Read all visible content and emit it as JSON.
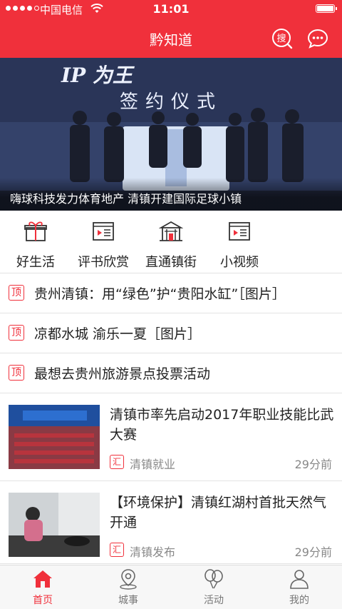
{
  "status_bar": {
    "carrier": "中国电信",
    "time": "11:01"
  },
  "header": {
    "title": "黔知道",
    "search_icon_char": "搜"
  },
  "banner": {
    "caption": "嗨球科技发力体育地产 清镇开建国际足球小镇",
    "stage_logo": "IP 为王",
    "stage_text": "签约仪式"
  },
  "quick_menu": [
    {
      "label": "好生活",
      "icon": "gift-icon"
    },
    {
      "label": "评书欣赏",
      "icon": "video-list-icon"
    },
    {
      "label": "直通镇街",
      "icon": "building-icon"
    },
    {
      "label": "小视频",
      "icon": "video-list-icon"
    }
  ],
  "pinned": {
    "tag": "顶",
    "items": [
      "贵州清镇：用“绿色”护“贵阳水缸”［图片］",
      "凉都水城 渝乐一夏［图片］",
      "最想去贵州旅游景点投票活动"
    ]
  },
  "news": {
    "source_tag": "汇",
    "items": [
      {
        "title": "清镇市率先启动2017年职业技能比武大赛",
        "source": "清镇就业",
        "time": "29分前"
      },
      {
        "title": "【环境保护】清镇红湖村首批天然气开通",
        "source": "清镇发布",
        "time": "29分前"
      }
    ]
  },
  "tab_bar": [
    {
      "label": "首页",
      "icon": "home-icon",
      "active": true
    },
    {
      "label": "城事",
      "icon": "map-pin-icon",
      "active": false
    },
    {
      "label": "活动",
      "icon": "balloons-icon",
      "active": false
    },
    {
      "label": "我的",
      "icon": "user-icon",
      "active": false
    }
  ],
  "colors": {
    "accent": "#f0303b",
    "text": "#222222",
    "muted": "#888888"
  }
}
